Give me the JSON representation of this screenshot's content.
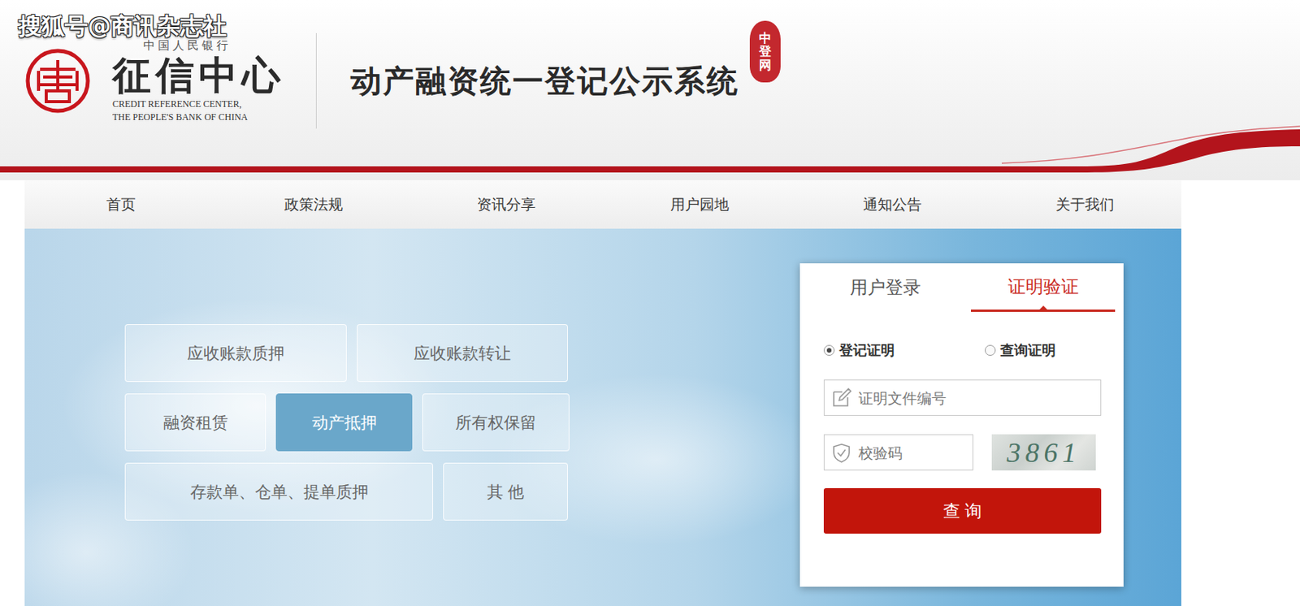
{
  "watermark": "搜狐号@商讯杂志社",
  "logo": {
    "top": "中国人民银行",
    "name": "征信中心",
    "en_line1": "CREDIT REFERENCE CENTER,",
    "en_line2": "THE PEOPLE'S BANK OF CHINA"
  },
  "system_title": "动产融资统一登记公示系统",
  "seal": "中登网",
  "nav": [
    "首页",
    "政策法规",
    "资讯分享",
    "用户园地",
    "通知公告",
    "关于我们"
  ],
  "categories": [
    [
      {
        "label": "应收账款质押",
        "selected": false
      },
      {
        "label": "应收账款转让",
        "selected": false
      }
    ],
    [
      {
        "label": "融资租赁",
        "selected": false
      },
      {
        "label": "动产抵押",
        "selected": true
      },
      {
        "label": "所有权保留",
        "selected": false
      }
    ],
    [
      {
        "label": "存款单、仓单、提单质押",
        "selected": false
      },
      {
        "label": "其 他",
        "selected": false
      }
    ]
  ],
  "login": {
    "tabs": [
      {
        "label": "用户登录",
        "selected": false
      },
      {
        "label": "证明验证",
        "selected": true
      }
    ],
    "radios": [
      {
        "label": "登记证明",
        "selected": true
      },
      {
        "label": "查询证明",
        "selected": false
      }
    ],
    "certificate_input": {
      "placeholder": "证明文件编号"
    },
    "code_input": {
      "placeholder": "校验码"
    },
    "captcha": "3861",
    "button": "查 询"
  }
}
